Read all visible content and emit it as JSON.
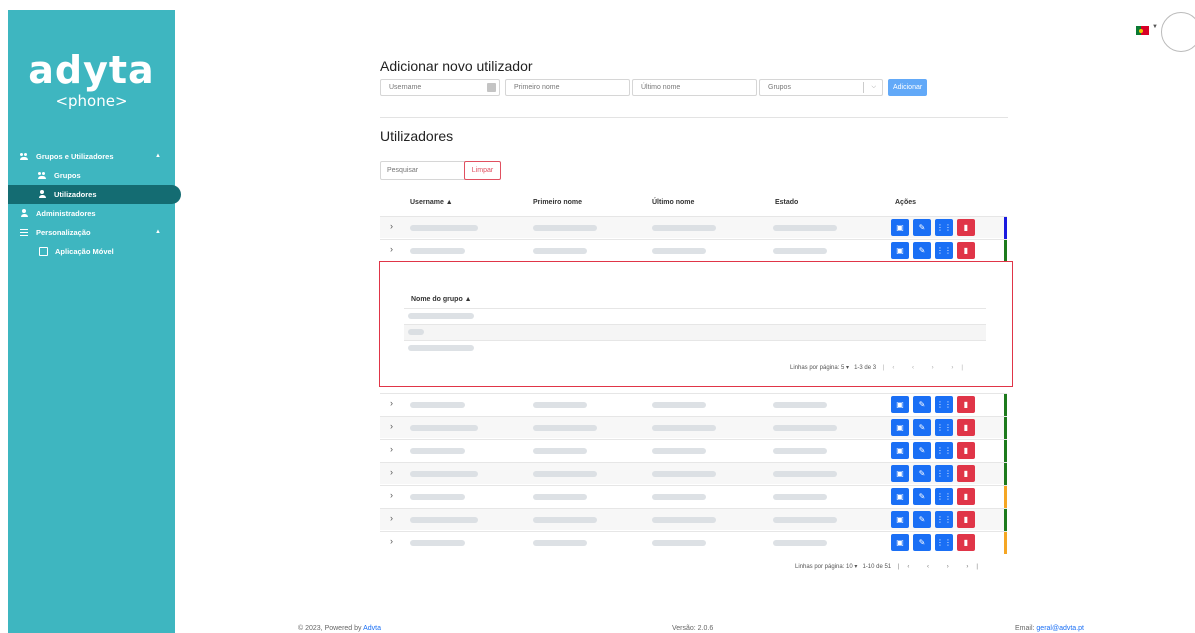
{
  "sidebar": {
    "logo_text": "adyta",
    "logo_sub": "<phone>",
    "items": [
      {
        "label": "Grupos e Utilizadores",
        "icon": "users-icon"
      },
      {
        "label": "Grupos",
        "icon": "group-icon"
      },
      {
        "label": "Utilizadores",
        "icon": "user-icon"
      },
      {
        "label": "Administradores",
        "icon": "admin-icon"
      },
      {
        "label": "Personalização",
        "icon": "menu-icon"
      },
      {
        "label": "Aplicação Móvel",
        "icon": "phone-icon"
      }
    ],
    "colors": {
      "bg": "#3eb6c0",
      "active": "#146c72"
    }
  },
  "add_user": {
    "title": "Adicionar novo utilizador",
    "username_placeholder": "Username",
    "first_name_placeholder": "Primeiro nome",
    "last_name_placeholder": "Último nome",
    "groups_placeholder": "Grupos",
    "add_label": "Adicionar"
  },
  "users": {
    "title": "Utilizadores",
    "search_placeholder": "Pesquisar",
    "clear_label": "Limpar",
    "columns": [
      "Username ▲",
      "Primeiro nome",
      "Último nome",
      "Estado",
      "Ações"
    ],
    "action_icons": [
      "id-card-icon",
      "edit-icon",
      "keypad-icon",
      "trash-icon"
    ],
    "rows": [
      {
        "status_color": "#1a1adf"
      },
      {
        "status_color": "#1d7a1d"
      },
      {
        "status_color": "#f5a623",
        "expanded": true
      },
      {
        "status_color": "#1d7a1d"
      },
      {
        "status_color": "#1d7a1d"
      },
      {
        "status_color": "#1d7a1d"
      },
      {
        "status_color": "#1d7a1d"
      },
      {
        "status_color": "#f5a623"
      },
      {
        "status_color": "#1d7a1d"
      },
      {
        "status_color": "#f5a623"
      }
    ],
    "expanded_table": {
      "column": "Nome do grupo ▲",
      "pager_label": "Linhas por página:",
      "pager_size": "5",
      "pager_range": "1-3 de 3"
    },
    "pager_label": "Linhas por página:",
    "pager_size": "10",
    "pager_range": "1-10 de 51"
  },
  "footer": {
    "copyright": "© 2023, Powered by ",
    "brand": "Advta",
    "version": "Versão: 2.0.6",
    "email_label": "Email: ",
    "email": "geral@advta.pt"
  }
}
